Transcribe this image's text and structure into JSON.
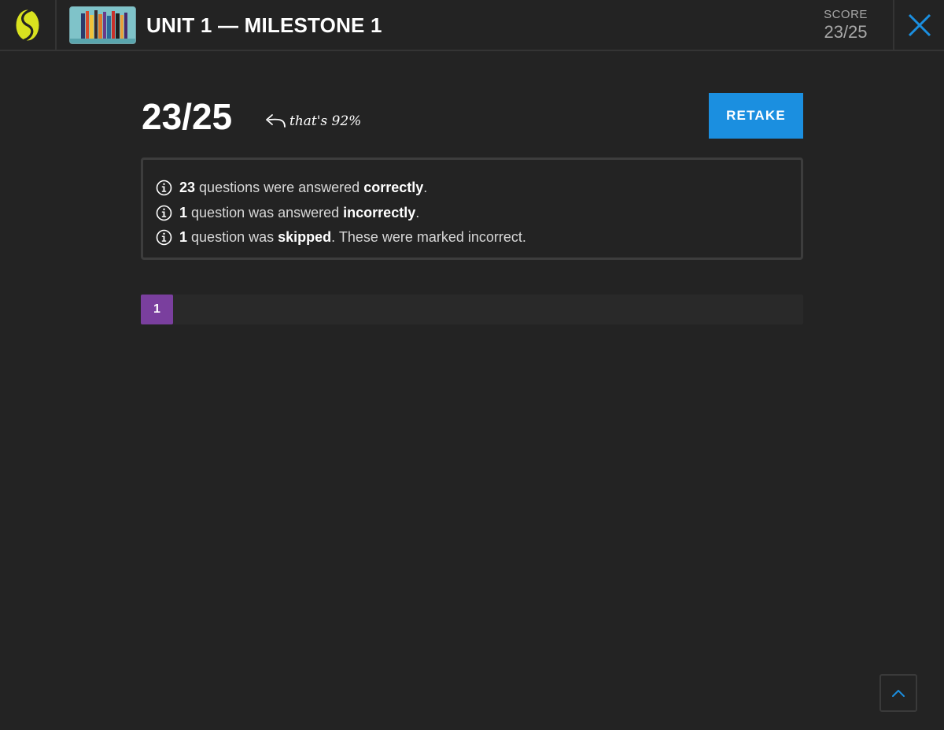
{
  "header": {
    "logo_icon": "sparknotes-s-logo-icon",
    "thumbnail_icon": "unit-thumbnail-image",
    "title": "UNIT 1 — MILESTONE 1",
    "score_label": "SCORE",
    "score_value": "23/25",
    "close_icon": "close-icon"
  },
  "summary": {
    "score": "23/25",
    "percent_note": "that's 92%",
    "retake_label": "RETAKE"
  },
  "results": [
    {
      "count": "23",
      "pre": "questions were answered",
      "emph": "correctly",
      "post": "."
    },
    {
      "count": "1",
      "pre": "question was answered",
      "emph": "incorrectly",
      "post": "."
    },
    {
      "count": "1",
      "pre": "question was",
      "emph": "skipped",
      "post": ". These were marked incorrect."
    }
  ],
  "questions": [
    {
      "label": "1",
      "status_color": "#7a3f9e"
    }
  ],
  "colors": {
    "background": "#232323",
    "accent_blue": "#1b8fe0",
    "logo_yellow": "#d9e21f",
    "question_purple": "#7a3f9e"
  },
  "scroll_top_icon": "chevron-up-icon"
}
